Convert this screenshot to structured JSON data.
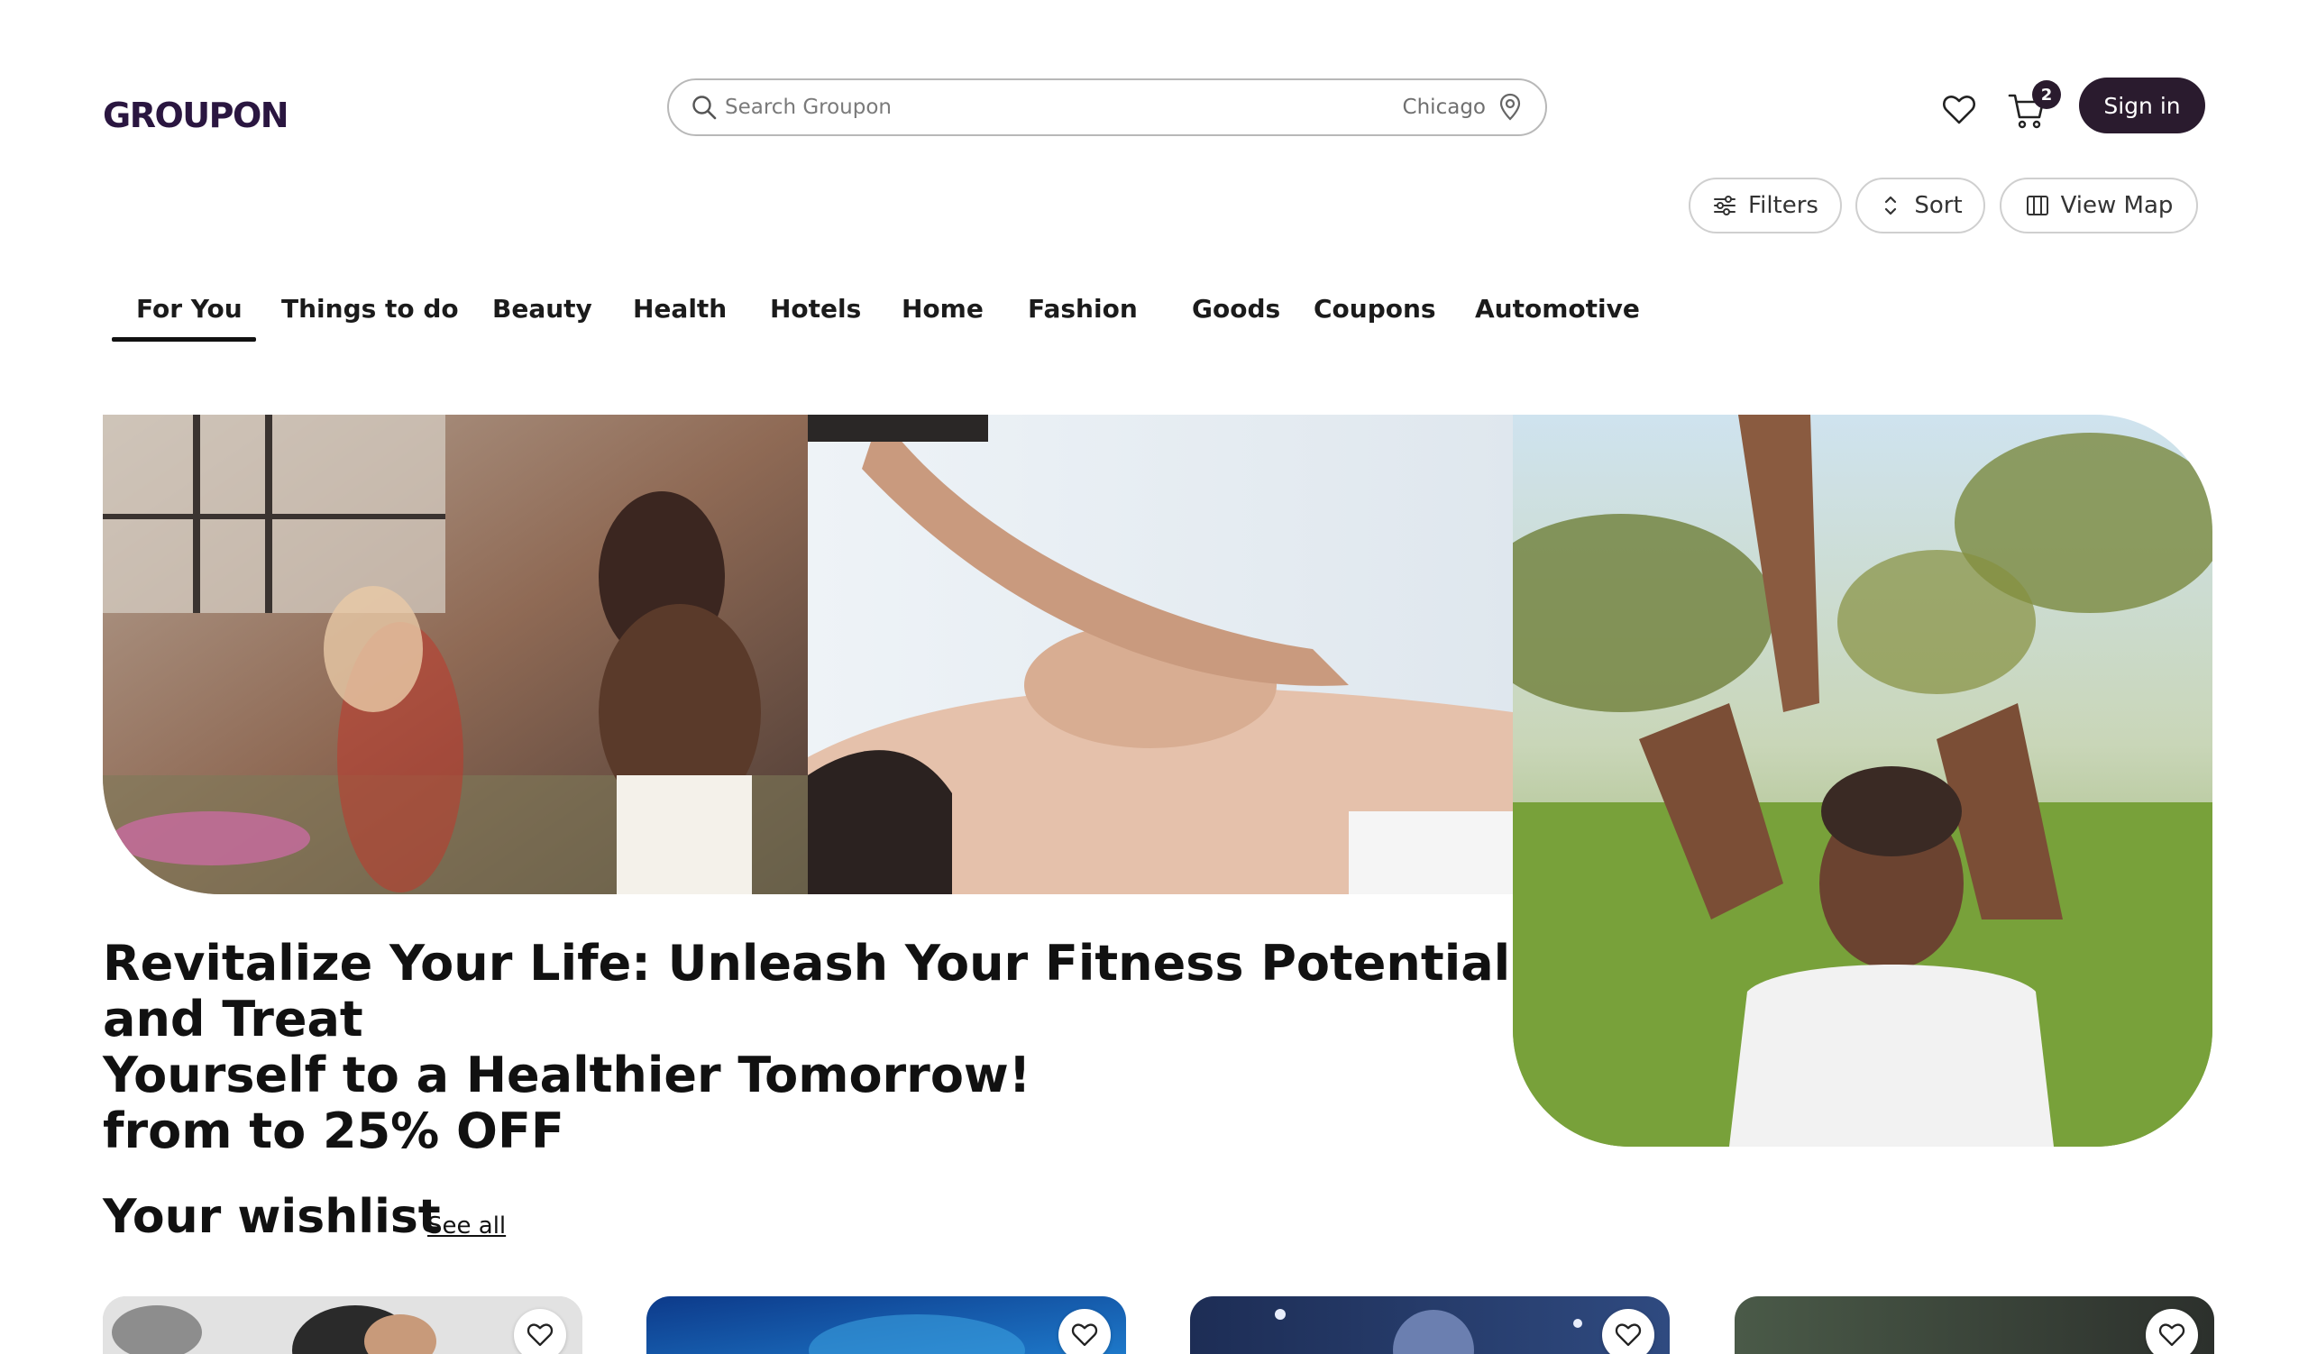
{
  "brand": {
    "logo_text": "GROUPON",
    "accent": "#2a1b2e"
  },
  "search": {
    "placeholder": "Search Groupon",
    "location": "Chicago"
  },
  "header": {
    "cart_count": "2",
    "signin_label": "Sign in"
  },
  "toolbar": {
    "filters_label": "Filters",
    "sort_label": "Sort",
    "map_label": "View Map"
  },
  "tabs": [
    {
      "label": "For You",
      "active": true
    },
    {
      "label": "Things to do"
    },
    {
      "label": "Beauty"
    },
    {
      "label": "Health"
    },
    {
      "label": "Hotels"
    },
    {
      "label": "Home"
    },
    {
      "label": "Fashion"
    },
    {
      "label": "Goods"
    },
    {
      "label": "Coupons"
    },
    {
      "label": "Automotive"
    }
  ],
  "hero": {
    "headline_line1": "Revitalize Your Life: Unleash Your Fitness Potential and Treat",
    "headline_line2": "Yourself to a Healthier Tomorrow!",
    "headline_line3": "from to 25% OFF"
  },
  "wishlist": {
    "title": "Your wishlist",
    "see_all": "See all"
  },
  "icons": {
    "search": "search-icon",
    "location": "location-pin-icon",
    "wishlist": "heart-icon",
    "cart": "cart-icon",
    "filters": "sliders-icon",
    "sort": "sort-icon",
    "map": "map-icon"
  }
}
